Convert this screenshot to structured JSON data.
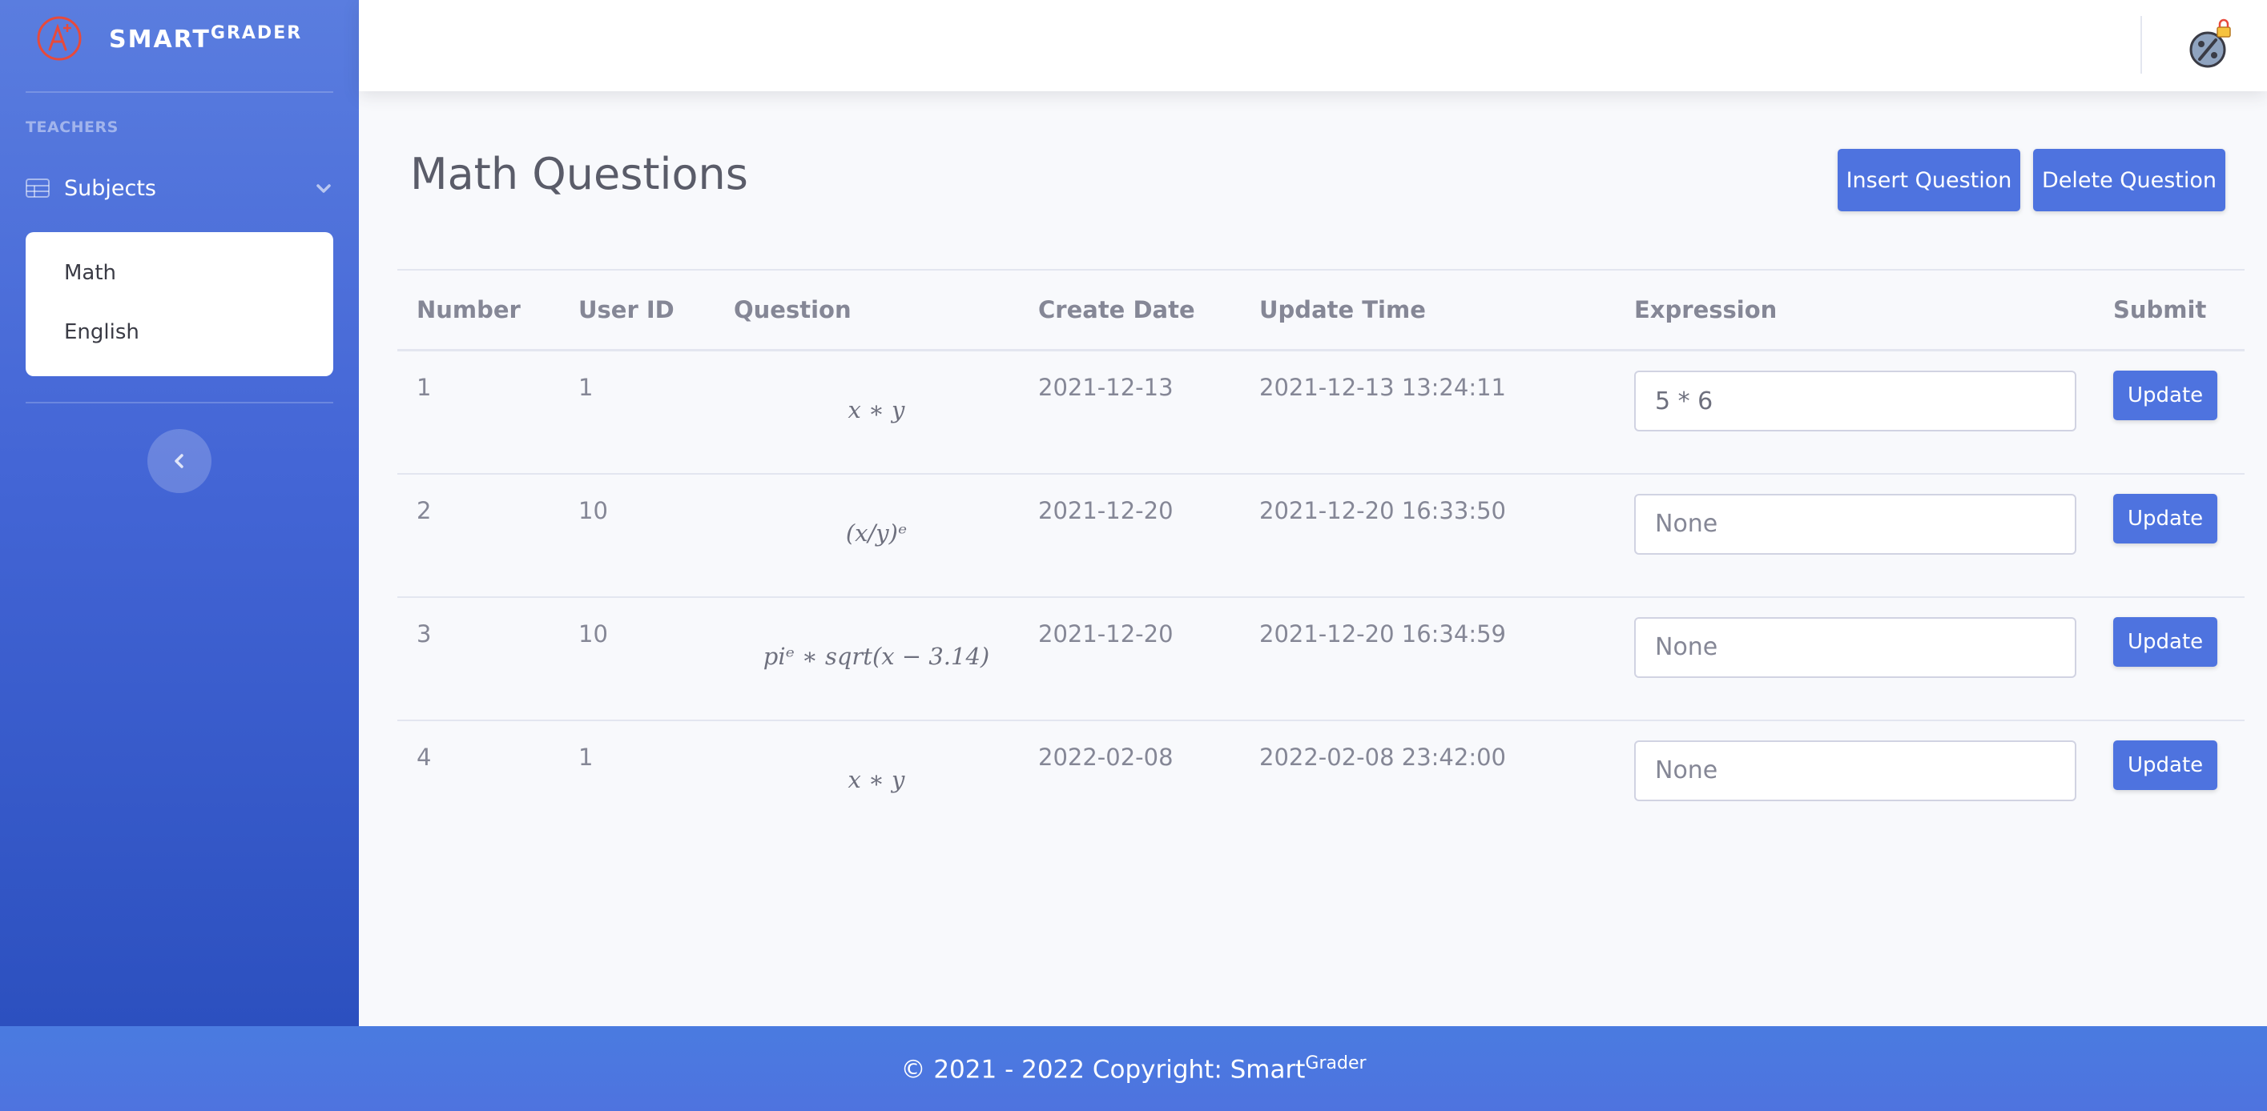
{
  "brand": {
    "name": "SMART",
    "sup": "GRADER"
  },
  "sidebar": {
    "heading": "TEACHERS",
    "nav_label": "Subjects",
    "items": [
      {
        "label": "Math"
      },
      {
        "label": "English"
      }
    ]
  },
  "page": {
    "title": "Math Questions"
  },
  "toolbar": {
    "insert_label": "Insert Question",
    "delete_label": "Delete Question"
  },
  "table": {
    "headers": [
      "Number",
      "User ID",
      "Question",
      "Create Date",
      "Update Time",
      "Expression",
      "Submit"
    ],
    "rows": [
      {
        "number": "1",
        "user_id": "1",
        "question": "x ∗ y",
        "create_date": "2021-12-13",
        "update_time": "2021-12-13 13:24:11",
        "expression_value": "5 * 6",
        "expression_placeholder": "",
        "submit": "Update"
      },
      {
        "number": "2",
        "user_id": "10",
        "question": "(x/y)ᵉ",
        "create_date": "2021-12-20",
        "update_time": "2021-12-20 16:33:50",
        "expression_value": "",
        "expression_placeholder": "None",
        "submit": "Update"
      },
      {
        "number": "3",
        "user_id": "10",
        "question": "piᵉ ∗ sqrt(x − 3.14)",
        "create_date": "2021-12-20",
        "update_time": "2021-12-20 16:34:59",
        "expression_value": "",
        "expression_placeholder": "None",
        "submit": "Update"
      },
      {
        "number": "4",
        "user_id": "1",
        "question": "x ∗ y",
        "create_date": "2022-02-08",
        "update_time": "2022-02-08 23:42:00",
        "expression_value": "",
        "expression_placeholder": "None",
        "submit": "Update"
      }
    ]
  },
  "footer": {
    "text": "© 2021 - 2022 Copyright: Smart",
    "sup": "Grader"
  },
  "colors": {
    "primary": "#4e73df",
    "sidebar_top": "#5a7ddf",
    "sidebar_bottom": "#2c50bf",
    "logo": "#e74a3b"
  }
}
